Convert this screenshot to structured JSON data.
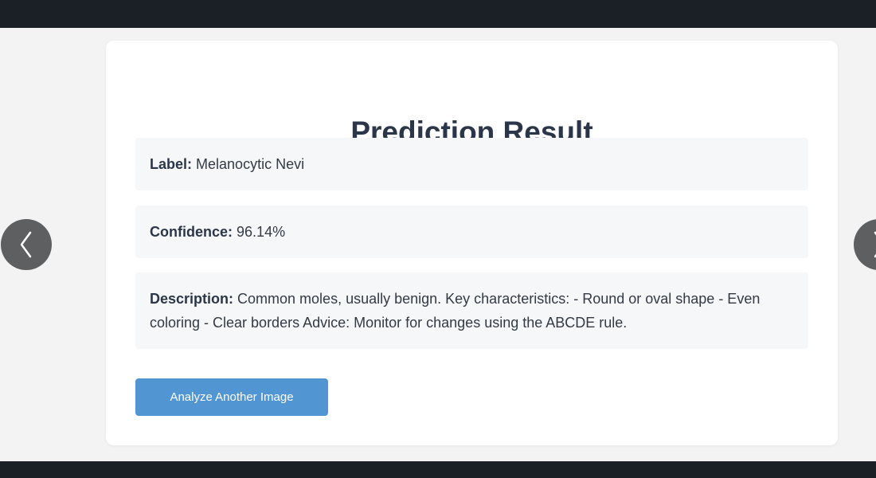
{
  "result": {
    "title": "Prediction Result",
    "label_key": "Label:",
    "label_value": "Melanocytic Nevi",
    "confidence_key": "Confidence:",
    "confidence_value": "96.14%",
    "description_key": "Description:",
    "description_value": "Common moles, usually benign. Key characteristics: - Round or oval shape - Even coloring - Clear borders Advice: Monitor for changes using the ABCDE rule.",
    "action_button": "Analyze Another Image"
  },
  "navigation": {
    "prev_icon": "chevron-left-icon",
    "next_icon": "chevron-right-icon"
  },
  "colors": {
    "frame": "#1b1f26",
    "page_background": "#f3f3f3",
    "card": "#ffffff",
    "field_background": "#f6f7f9",
    "button": "#5196d3",
    "title_text": "#2b3648",
    "nav_button": "#5e5f61"
  }
}
